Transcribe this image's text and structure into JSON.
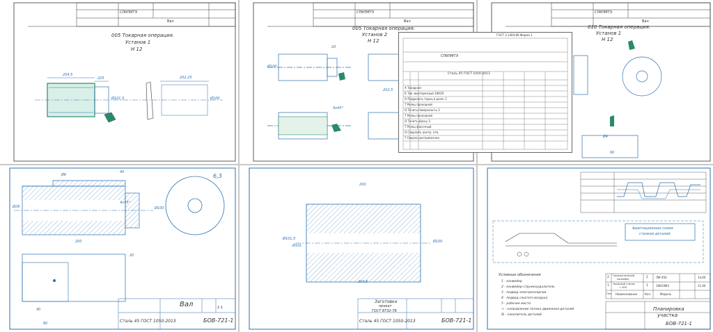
{
  "sheets": {
    "s1": {
      "title": "005 Токарная операция.",
      "setup": "Установ 1",
      "mark": "Н 12",
      "header_code": "СПбПМТЭ",
      "header_name": "Вал",
      "dims": {
        "d1": "204,5",
        "d2": "225",
        "d3": "202,25",
        "d4": "Ø100",
        "d5": "Ø101,5"
      }
    },
    "s2": {
      "title": "005 Токарная операция.",
      "setup": "Установ 2",
      "mark": "Н 12",
      "header_code": "СПбПМТЭ",
      "header_name": "Вал",
      "dims": {
        "d1": "20",
        "d2": "Ø100",
        "d3": "4х45°",
        "d4": "202,5"
      }
    },
    "s3": {
      "title": "010 Токарная операция.",
      "setup": "Установ 1",
      "mark": "Н 12",
      "header_code": "СПбПМТЭ",
      "header_name": "Вал",
      "dims": {
        "d1": "Ø4",
        "d2": "60"
      }
    },
    "card": {
      "doc": "ГОСТ 3.1404-86  Форма 1",
      "code": "СПбПМТЭ",
      "material": "Сталь 45 ГОСТ 1050-2013",
      "rows": [
        "А  Токарная",
        "Б  Ток.-винторезный 16К20",
        "О  Подрезать торец в разм. 1",
        "Т  Резец проходной",
        "О  Точить поверхность 2",
        "Т  Резец проходной",
        "О  Точить фаску 3",
        "Т  Резец фасочный",
        "О  Сверлить центр. отв.",
        "Т  Сверло центровочное"
      ]
    },
    "s4": {
      "title": "Вал",
      "material": "Сталь 45 ГОСТ 1050-2013",
      "code": "БОВ-721-1",
      "scale": "1:1",
      "roughness": "6,3",
      "dims": {
        "d1": "Ø6",
        "d2": "40",
        "d3": "Ø28",
        "d4": "4х45°",
        "d5": "Ø100",
        "d6": "200",
        "d7": "20",
        "d8": "40",
        "d9": "80"
      }
    },
    "s5": {
      "title": "Заготовка",
      "subtitle": "прокат",
      "std": "ГОСТ 8732-78",
      "material": "Сталь 45 ГОСТ 1050-2013",
      "code": "БОВ-721-1",
      "dims": {
        "d1": "200",
        "d2": "Ø101,5",
        "d3": "Ø100",
        "d4": "204,5",
        "d5": "Ø101"
      }
    },
    "s6": {
      "title": "Планировка",
      "subtitle": "участка",
      "code": "БОВ-721-1",
      "scheme_label": "Адаптационная схема",
      "scheme_label2": "станков деталей",
      "legend_title": "Условные обозначения",
      "legend": [
        "1 - конвейер",
        "2 - конвейер-стружкоудалитель",
        "3 - подвод электроэнергии",
        "4 - подвод сжатого воздуха",
        "5 - рабочее место",
        "→ - направление потока движения деталей",
        "☒ - накопитель деталей"
      ],
      "table": [
        {
          "pos": "2",
          "name": "Горизонтальный",
          "name2": "конвейер",
          "model": "ЛМ-450",
          "qty": "2",
          "power": "14,00"
        },
        {
          "pos": "1",
          "name": "Токарный станок",
          "name2": "с ЧПУ",
          "model": "16К20Ф3",
          "qty": "1",
          "power": "11,00"
        }
      ],
      "head": {
        "pos": "Поз.",
        "name": "Наименование",
        "qty": "Кол",
        "model": "Модель"
      }
    }
  }
}
